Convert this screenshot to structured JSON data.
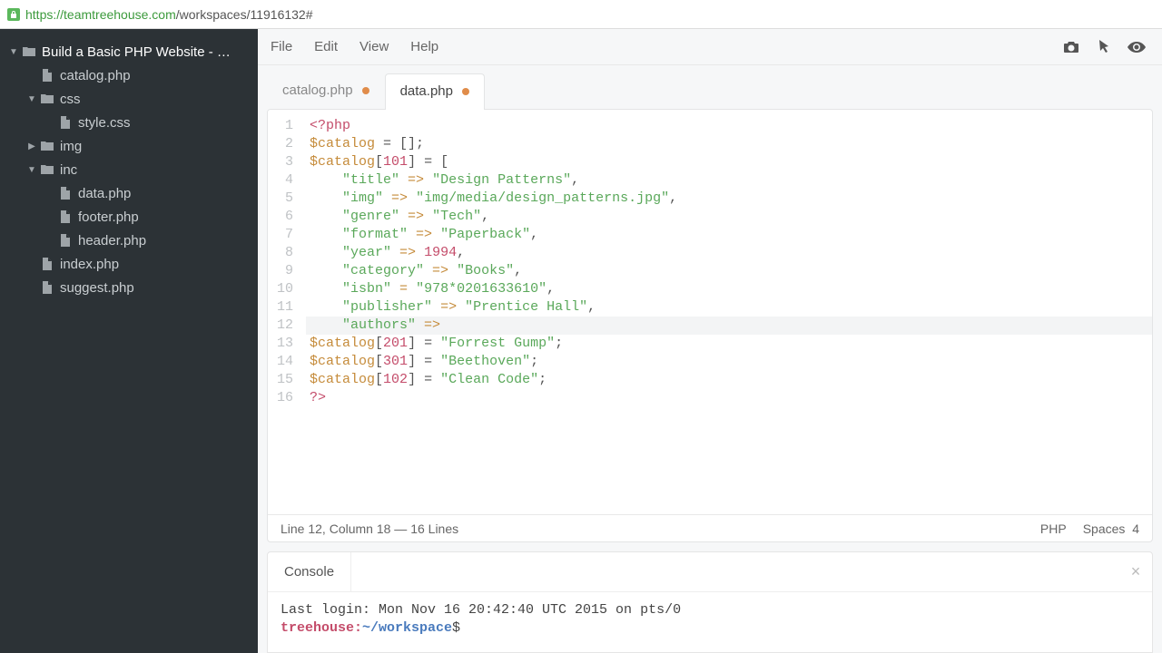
{
  "url": {
    "host": "https://teamtreehouse.com",
    "path": "/workspaces/11916132#"
  },
  "menubar": {
    "items": [
      "File",
      "Edit",
      "View",
      "Help"
    ]
  },
  "sidebar": {
    "project": "Build a Basic PHP Website - …",
    "tree": [
      {
        "name": "catalog.php",
        "type": "file",
        "depth": 1
      },
      {
        "name": "css",
        "type": "folder-open",
        "depth": 1
      },
      {
        "name": "style.css",
        "type": "file",
        "depth": 2
      },
      {
        "name": "img",
        "type": "folder-closed",
        "depth": 1
      },
      {
        "name": "inc",
        "type": "folder-open",
        "depth": 1
      },
      {
        "name": "data.php",
        "type": "file",
        "depth": 2
      },
      {
        "name": "footer.php",
        "type": "file",
        "depth": 2
      },
      {
        "name": "header.php",
        "type": "file",
        "depth": 2
      },
      {
        "name": "index.php",
        "type": "file",
        "depth": 1
      },
      {
        "name": "suggest.php",
        "type": "file",
        "depth": 1
      }
    ]
  },
  "tabs": [
    {
      "label": "catalog.php",
      "active": false,
      "dirty": true
    },
    {
      "label": "data.php",
      "active": true,
      "dirty": true
    }
  ],
  "code": {
    "highlight_line": 12,
    "lines": [
      [
        {
          "t": "<?php",
          "c": "c-php"
        }
      ],
      [
        {
          "t": "$catalog",
          "c": "c-key"
        },
        {
          "t": " = [];",
          "c": "c-def"
        }
      ],
      [
        {
          "t": "$catalog",
          "c": "c-key"
        },
        {
          "t": "[",
          "c": "c-def"
        },
        {
          "t": "101",
          "c": "c-num"
        },
        {
          "t": "] = [",
          "c": "c-def"
        }
      ],
      [
        {
          "t": "    ",
          "c": ""
        },
        {
          "t": "\"title\"",
          "c": "c-str"
        },
        {
          "t": " => ",
          "c": "c-op"
        },
        {
          "t": "\"Design Patterns\"",
          "c": "c-str"
        },
        {
          "t": ",",
          "c": "c-def"
        }
      ],
      [
        {
          "t": "    ",
          "c": ""
        },
        {
          "t": "\"img\"",
          "c": "c-str"
        },
        {
          "t": " => ",
          "c": "c-op"
        },
        {
          "t": "\"img/media/design_patterns.jpg\"",
          "c": "c-str"
        },
        {
          "t": ",",
          "c": "c-def"
        }
      ],
      [
        {
          "t": "    ",
          "c": ""
        },
        {
          "t": "\"genre\"",
          "c": "c-str"
        },
        {
          "t": " => ",
          "c": "c-op"
        },
        {
          "t": "\"Tech\"",
          "c": "c-str"
        },
        {
          "t": ",",
          "c": "c-def"
        }
      ],
      [
        {
          "t": "    ",
          "c": ""
        },
        {
          "t": "\"format\"",
          "c": "c-str"
        },
        {
          "t": " => ",
          "c": "c-op"
        },
        {
          "t": "\"Paperback\"",
          "c": "c-str"
        },
        {
          "t": ",",
          "c": "c-def"
        }
      ],
      [
        {
          "t": "    ",
          "c": ""
        },
        {
          "t": "\"year\"",
          "c": "c-str"
        },
        {
          "t": " => ",
          "c": "c-op"
        },
        {
          "t": "1994",
          "c": "c-num"
        },
        {
          "t": ",",
          "c": "c-def"
        }
      ],
      [
        {
          "t": "    ",
          "c": ""
        },
        {
          "t": "\"category\"",
          "c": "c-str"
        },
        {
          "t": " => ",
          "c": "c-op"
        },
        {
          "t": "\"Books\"",
          "c": "c-str"
        },
        {
          "t": ",",
          "c": "c-def"
        }
      ],
      [
        {
          "t": "    ",
          "c": ""
        },
        {
          "t": "\"isbn\"",
          "c": "c-str"
        },
        {
          "t": " = ",
          "c": "c-op"
        },
        {
          "t": "\"978*0201633610\"",
          "c": "c-str"
        },
        {
          "t": ",",
          "c": "c-def"
        }
      ],
      [
        {
          "t": "    ",
          "c": ""
        },
        {
          "t": "\"publisher\"",
          "c": "c-str"
        },
        {
          "t": " => ",
          "c": "c-op"
        },
        {
          "t": "\"Prentice Hall\"",
          "c": "c-str"
        },
        {
          "t": ",",
          "c": "c-def"
        }
      ],
      [
        {
          "t": "    ",
          "c": ""
        },
        {
          "t": "\"authors\"",
          "c": "c-str"
        },
        {
          "t": " =>",
          "c": "c-op"
        }
      ],
      [
        {
          "t": "$catalog",
          "c": "c-key"
        },
        {
          "t": "[",
          "c": "c-def"
        },
        {
          "t": "201",
          "c": "c-num"
        },
        {
          "t": "] = ",
          "c": "c-def"
        },
        {
          "t": "\"Forrest Gump\"",
          "c": "c-str"
        },
        {
          "t": ";",
          "c": "c-def"
        }
      ],
      [
        {
          "t": "$catalog",
          "c": "c-key"
        },
        {
          "t": "[",
          "c": "c-def"
        },
        {
          "t": "301",
          "c": "c-num"
        },
        {
          "t": "] = ",
          "c": "c-def"
        },
        {
          "t": "\"Beethoven\"",
          "c": "c-str"
        },
        {
          "t": ";",
          "c": "c-def"
        }
      ],
      [
        {
          "t": "$catalog",
          "c": "c-key"
        },
        {
          "t": "[",
          "c": "c-def"
        },
        {
          "t": "102",
          "c": "c-num"
        },
        {
          "t": "] = ",
          "c": "c-def"
        },
        {
          "t": "\"Clean Code\"",
          "c": "c-str"
        },
        {
          "t": ";",
          "c": "c-def"
        }
      ],
      [
        {
          "t": "?>",
          "c": "c-php"
        }
      ]
    ]
  },
  "status": {
    "left": "Line 12, Column 18 — 16 Lines",
    "lang": "PHP",
    "indent": "Spaces",
    "indent_n": "4"
  },
  "console": {
    "tab": "Console",
    "last_login": "Last login: Mon Nov 16 20:42:40 UTC 2015 on pts/0",
    "prompt_host": "treehouse:",
    "prompt_path": "~/workspace",
    "prompt_sym": "$"
  }
}
